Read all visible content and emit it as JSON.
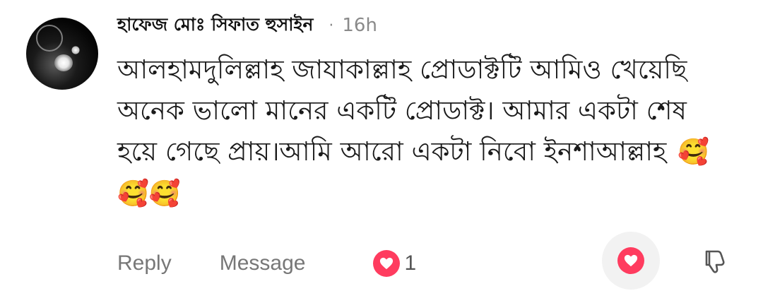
{
  "comment": {
    "author": "হাফেজ মোঃ সিফাত হুসাইন",
    "separator": "·",
    "time": "16h",
    "text": "আলহামদুলিল্লাহ জাযাকাল্লাহ প্রোডাক্টটি আমিও খেয়েছি অনেক ভালো মানের একটি প্রোডাক্ট। আমার একটা শেষ হয়ে গেছে প্রায়।আমি আরো একটা নিবো ইনশাআল্লাহ",
    "emojis": "🥰🥰🥰"
  },
  "actions": {
    "reply_label": "Reply",
    "message_label": "Message",
    "reaction_count": "1"
  },
  "icons": {
    "avatar": "avatar-image",
    "reaction": "heart-icon",
    "like": "heart-icon",
    "dislike": "thumbs-down-icon"
  },
  "colors": {
    "heart": "#ff3c5f",
    "secondary_text": "#8a8a8a",
    "like_button_bg": "#f2f2f2"
  }
}
